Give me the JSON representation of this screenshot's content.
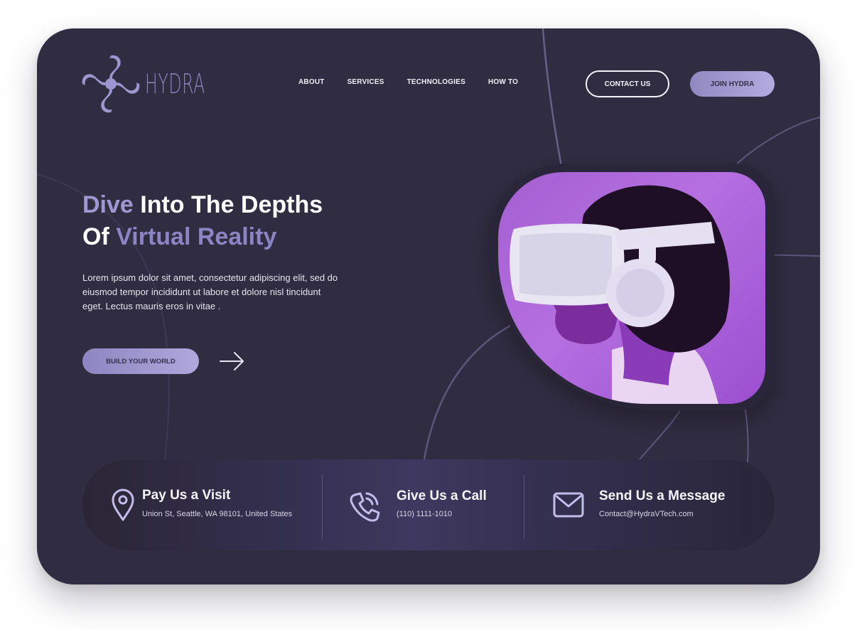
{
  "brand": {
    "name": "HYDRA",
    "logo_icon": "hydra-swirl-logo-icon"
  },
  "nav": {
    "items": [
      {
        "label": "ABOUT"
      },
      {
        "label": "SERVICES"
      },
      {
        "label": "TECHNOLOGIES"
      },
      {
        "label": "HOW TO"
      }
    ],
    "contact_label": "CONTACT US",
    "join_label": "JOIN HYDRA"
  },
  "hero": {
    "title_word1": "Dive",
    "title_rest1": " Into The Depths",
    "title_word2": "Of ",
    "title_rest2": "Virtual Reality",
    "description": "Lorem ipsum dolor sit amet, consectetur adipiscing elit, sed do eiusmod tempor incididunt ut labore et dolore nisl tincidunt eget. Lectus mauris eros in vitae .",
    "cta_label": "BUILD YOUR WORLD",
    "cta_arrow_icon": "arrow-right-icon",
    "image": "person-wearing-vr-headset-photo"
  },
  "contact": {
    "items": [
      {
        "title": "Pay Us a Visit",
        "detail": "Union St, Seattle, WA 98101, United States",
        "icon": "location-pin-icon"
      },
      {
        "title": "Give Us a Call",
        "detail": "(110) 1111-1010",
        "icon": "phone-icon"
      },
      {
        "title": "Send Us a Message",
        "detail": "Contact@HydraVTech.com",
        "icon": "mail-icon"
      }
    ]
  },
  "colors": {
    "background": "#302c41",
    "accent": "#9f97d1",
    "hero_purple": "#b56fe0"
  }
}
